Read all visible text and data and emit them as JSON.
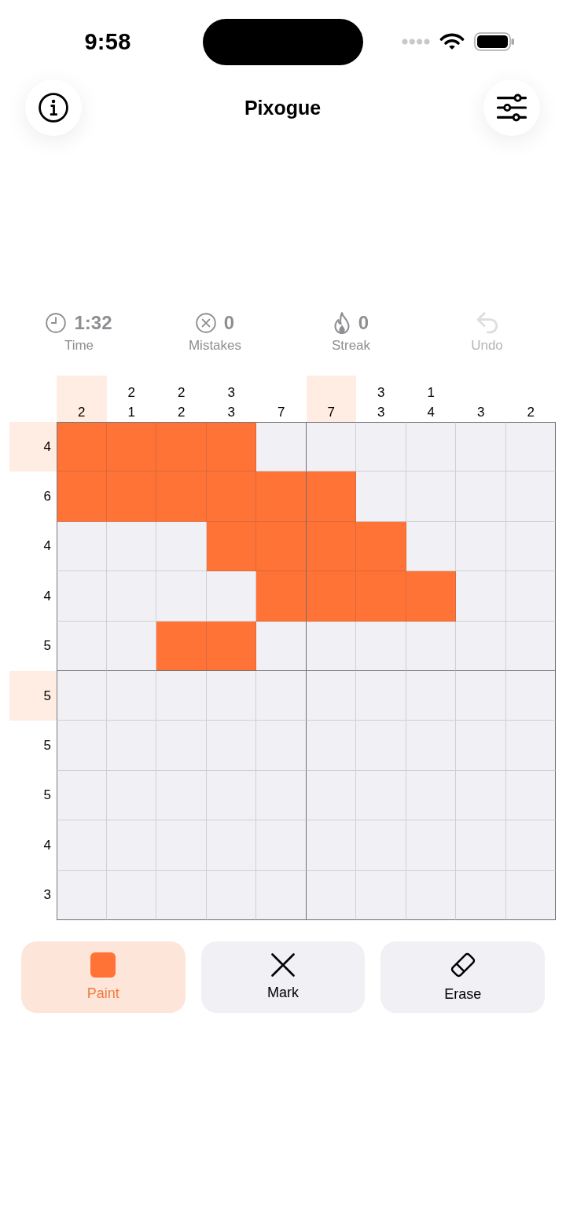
{
  "status_bar": {
    "time": "9:58"
  },
  "header": {
    "title": "Pixogue"
  },
  "stats": [
    {
      "kind": "timer",
      "value": "1:32",
      "label": "Time"
    },
    {
      "kind": "mistakes",
      "value": "0",
      "label": "Mistakes"
    },
    {
      "kind": "streak",
      "value": "0",
      "label": "Streak"
    }
  ],
  "undo": {
    "label": "Undo",
    "disabled": true
  },
  "board": {
    "columns": [
      {
        "clues": [
          "2"
        ],
        "highlighted": true
      },
      {
        "clues": [
          "2",
          "1"
        ],
        "highlighted": false
      },
      {
        "clues": [
          "2",
          "2"
        ],
        "highlighted": false
      },
      {
        "clues": [
          "3",
          "3"
        ],
        "highlighted": false
      },
      {
        "clues": [
          "7"
        ],
        "highlighted": false
      },
      {
        "clues": [
          "7"
        ],
        "highlighted": true
      },
      {
        "clues": [
          "3",
          "3"
        ],
        "highlighted": false
      },
      {
        "clues": [
          "1",
          "4"
        ],
        "highlighted": false
      },
      {
        "clues": [
          "3"
        ],
        "highlighted": false
      },
      {
        "clues": [
          "2"
        ],
        "highlighted": false
      }
    ],
    "rows": [
      {
        "clue": "4",
        "highlighted": true,
        "cells": [
          true,
          true,
          true,
          true,
          false,
          false,
          false,
          false,
          false,
          false
        ]
      },
      {
        "clue": "6",
        "highlighted": false,
        "cells": [
          true,
          true,
          true,
          true,
          true,
          true,
          false,
          false,
          false,
          false
        ]
      },
      {
        "clue": "4",
        "highlighted": false,
        "cells": [
          false,
          false,
          false,
          true,
          true,
          true,
          true,
          false,
          false,
          false
        ]
      },
      {
        "clue": "4",
        "highlighted": false,
        "cells": [
          false,
          false,
          false,
          false,
          true,
          true,
          true,
          true,
          false,
          false
        ]
      },
      {
        "clue": "5",
        "highlighted": false,
        "cells": [
          false,
          false,
          true,
          true,
          false,
          false,
          false,
          false,
          false,
          false
        ]
      },
      {
        "clue": "5",
        "highlighted": true,
        "cells": [
          false,
          false,
          false,
          false,
          false,
          false,
          false,
          false,
          false,
          false
        ]
      },
      {
        "clue": "5",
        "highlighted": false,
        "cells": [
          false,
          false,
          false,
          false,
          false,
          false,
          false,
          false,
          false,
          false
        ]
      },
      {
        "clue": "5",
        "highlighted": false,
        "cells": [
          false,
          false,
          false,
          false,
          false,
          false,
          false,
          false,
          false,
          false
        ]
      },
      {
        "clue": "4",
        "highlighted": false,
        "cells": [
          false,
          false,
          false,
          false,
          false,
          false,
          false,
          false,
          false,
          false
        ]
      },
      {
        "clue": "3",
        "highlighted": false,
        "cells": [
          false,
          false,
          false,
          false,
          false,
          false,
          false,
          false,
          false,
          false
        ]
      }
    ]
  },
  "tools": [
    {
      "kind": "paint",
      "label": "Paint",
      "selected": true
    },
    {
      "kind": "mark",
      "label": "Mark",
      "selected": false
    },
    {
      "kind": "erase",
      "label": "Erase",
      "selected": false
    }
  ]
}
